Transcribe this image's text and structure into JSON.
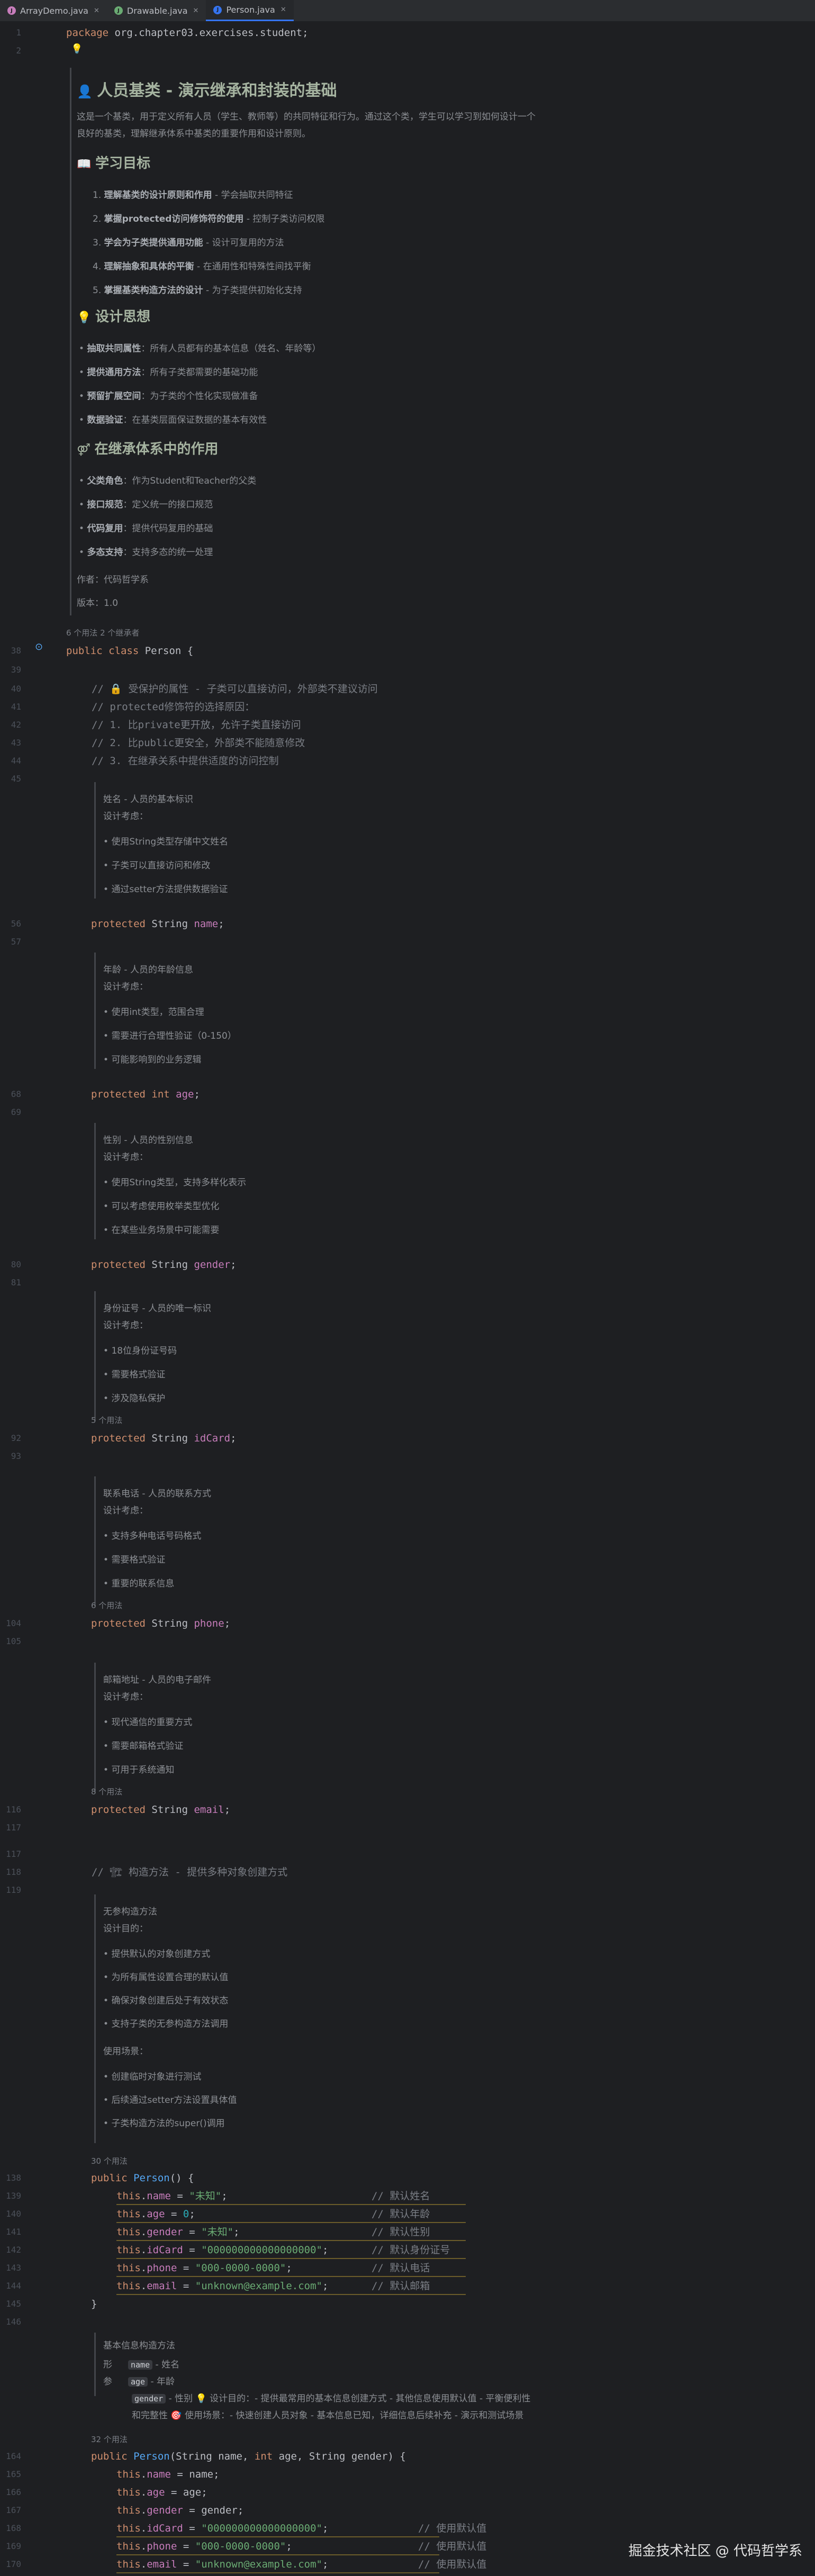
{
  "tabs": [
    {
      "label": "ArrayDemo.java",
      "icon_color": "#c77dbb"
    },
    {
      "label": "Drawable.java",
      "icon_color": "#6aab73"
    },
    {
      "label": "Person.java",
      "icon_color": "#3574f0",
      "active": true
    }
  ],
  "colors": {
    "accent": "#3574f0",
    "keyword": "#cf8e6d",
    "string": "#6aab73",
    "field": "#c77dbb",
    "comment": "#7a7e85",
    "number": "#2aacb8",
    "doc_heading": "#a5b3a0"
  },
  "code": {
    "line1": {
      "n": "1",
      "kw": "package",
      "rest": " org.chapter03.exercises.student;"
    },
    "line2": {
      "n": "2"
    },
    "doc_class": {
      "title": "人员基类 - 演示继承和封装的基础",
      "intro_1": "这是一个基类，用于定义所有人员（学生、教师等）的共同特征和行为。通过这个类，学生可以学习到如何设计一个",
      "intro_2": "良好的基类，理解继承体系中基类的重要作用和设计原则。",
      "goals_title": "学习目标",
      "goals": [
        {
          "n": "1.",
          "b": "理解基类的设计原则和作用",
          "t": " - 学会抽取共同特征"
        },
        {
          "n": "2.",
          "b": "掌握protected访问修饰符的使用",
          "t": " - 控制子类访问权限"
        },
        {
          "n": "3.",
          "b": "学会为子类提供通用功能",
          "t": " - 设计可复用的方法"
        },
        {
          "n": "4.",
          "b": "理解抽象和具体的平衡",
          "t": " - 在通用性和特殊性间找平衡"
        },
        {
          "n": "5.",
          "b": "掌握基类构造方法的设计",
          "t": " - 为子类提供初始化支持"
        }
      ],
      "thinking_title": "设计思想",
      "thinking": [
        {
          "b": "抽取共同属性",
          "t": "：所有人员都有的基本信息（姓名、年龄等）"
        },
        {
          "b": "提供通用方法",
          "t": "：所有子类都需要的基础功能"
        },
        {
          "b": "预留扩展空间",
          "t": "：为子类的个性化实现做准备"
        },
        {
          "b": "数据验证",
          "t": "：在基类层面保证数据的基本有效性"
        }
      ],
      "role_title": "在继承体系中的作用",
      "role": [
        {
          "b": "父类角色",
          "t": "：作为Student和Teacher的父类"
        },
        {
          "b": "接口规范",
          "t": "：定义统一的接口规范"
        },
        {
          "b": "代码复用",
          "t": "：提供代码复用的基础"
        },
        {
          "b": "多态支持",
          "t": "：支持多态的统一处理"
        }
      ],
      "author": "作者：代码哲学系",
      "version": "版本：1.0"
    },
    "class_hint": "6 个用法   2 个继承者",
    "class_line": {
      "n": "38",
      "kw": "public class",
      "name": " Person {"
    },
    "comments": [
      {
        "n": "40",
        "text": "// 🔒 受保护的属性 - 子类可以直接访问，外部类不建议访问"
      },
      {
        "n": "41",
        "text": "// protected修饰符的选择原因："
      },
      {
        "n": "42",
        "text": "// 1. 比private更开放，允许子类直接访问"
      },
      {
        "n": "43",
        "text": "// 2. 比public更安全，外部类不能随意修改"
      },
      {
        "n": "44",
        "text": "// 3. 在继承关系中提供适度的访问控制"
      }
    ],
    "fields": [
      {
        "doc_title": "姓名 - 人员的基本标识",
        "doc_sub": "设计考虑：",
        "items": [
          "使用String类型存储中文姓名",
          "子类可以直接访问和修改",
          "通过setter方法提供数据验证"
        ],
        "hint": "",
        "n": "56",
        "type": "String",
        "name": "name"
      },
      {
        "doc_title": "年龄 - 人员的年龄信息",
        "doc_sub": "设计考虑：",
        "items": [
          "使用int类型，范围合理",
          "需要进行合理性验证（0-150）",
          "可能影响到的业务逻辑"
        ],
        "hint": "",
        "n": "68",
        "type": "int",
        "name": "age"
      },
      {
        "doc_title": "性别 - 人员的性别信息",
        "doc_sub": "设计考虑：",
        "items": [
          "使用String类型，支持多样化表示",
          "可以考虑使用枚举类型优化",
          "在某些业务场景中可能需要"
        ],
        "hint": "",
        "n": "80",
        "type": "String",
        "name": "gender"
      },
      {
        "doc_title": "身份证号 - 人员的唯一标识",
        "doc_sub": "设计考虑：",
        "items": [
          "18位身份证号码",
          "需要格式验证",
          "涉及隐私保护"
        ],
        "hint": "5 个用法",
        "n": "92",
        "type": "String",
        "name": "idCard"
      },
      {
        "doc_title": "联系电话 - 人员的联系方式",
        "doc_sub": "设计考虑：",
        "items": [
          "支持多种电话号码格式",
          "需要格式验证",
          "重要的联系信息"
        ],
        "hint": "6 个用法",
        "n": "104",
        "type": "String",
        "name": "phone"
      },
      {
        "doc_title": "邮箱地址 - 人员的电子邮件",
        "doc_sub": "设计考虑：",
        "items": [
          "现代通信的重要方式",
          "需要邮箱格式验证",
          "可用于系统通知"
        ],
        "hint": "8 个用法",
        "n": "116",
        "type": "String",
        "name": "email"
      }
    ],
    "ctor_comment": {
      "n": "118",
      "text": "// 🏗 构造方法 - 提供多种对象创建方式"
    },
    "ctor_doc": {
      "title": "无参构造方法",
      "sub": "设计目的：",
      "items": [
        "提供默认的对象创建方式",
        "为所有属性设置合理的默认值",
        "确保对象创建后处于有效状态",
        "支持子类的无参构造方法调用"
      ],
      "sub2": "使用场景：",
      "items2": [
        "创建临时对象进行测试",
        "后续通过setter方法设置具体值",
        "子类构造方法的super()调用"
      ]
    },
    "ctor_hint": "30 个用法",
    "ctor_lines": [
      {
        "n": "138",
        "pre": "public ",
        "fn": "Person",
        "post": "() {"
      },
      {
        "n": "139",
        "fld": "name",
        "val": "\"未知\"",
        "isnum": false,
        "cm": "// 默认姓名"
      },
      {
        "n": "140",
        "fld": "age",
        "val": "0",
        "isnum": true,
        "cm": "// 默认年龄"
      },
      {
        "n": "141",
        "fld": "gender",
        "val": "\"未知\"",
        "isnum": false,
        "cm": "// 默认性别"
      },
      {
        "n": "142",
        "fld": "idCard",
        "val": "\"000000000000000000\"",
        "isnum": false,
        "cm": "// 默认身份证号"
      },
      {
        "n": "143",
        "fld": "phone",
        "val": "\"000-0000-0000\"",
        "isnum": false,
        "cm": "// 默认电话"
      },
      {
        "n": "144",
        "fld": "email",
        "val": "\"unknown@example.com\"",
        "isnum": false,
        "cm": "// 默认邮箱"
      },
      {
        "n": "145",
        "close": "}"
      },
      {
        "n": "146"
      }
    ],
    "ctor2_doc": {
      "title": "基本信息构造方法",
      "p1_label": "形",
      "p1": "name",
      "p1t": "- 姓名",
      "p2_label": "参",
      "p2": "age",
      "p2t": "- 年龄",
      "p3": "gender",
      "p3t": "- 性别 💡 设计目的：- 提供最常用的基本信息创建方式 - 其他信息使用默认值 - 平衡便利性",
      "p4": "和完整性 🎯 使用场景：- 快速创建人员对象 - 基本信息已知，详细信息后续补充 - 演示和测试场景"
    },
    "ctor2_hint": "32 个用法",
    "ctor2_lines": [
      {
        "n": "164",
        "sig": "Person(String name, int age, String gender) {"
      },
      {
        "n": "165",
        "fld": "name",
        "val": "name",
        "kind": "id",
        "cm": ""
      },
      {
        "n": "166",
        "fld": "age",
        "val": "age",
        "kind": "id",
        "cm": ""
      },
      {
        "n": "167",
        "fld": "gender",
        "val": "gender",
        "kind": "id",
        "cm": ""
      },
      {
        "n": "168",
        "fld": "idCard",
        "val": "\"000000000000000000\"",
        "kind": "str",
        "cm": "// 使用默认值"
      },
      {
        "n": "169",
        "fld": "phone",
        "val": "\"000-0000-0000\"",
        "kind": "str",
        "cm": "// 使用默认值"
      },
      {
        "n": "170",
        "fld": "email",
        "val": "\"unknown@example.com\"",
        "kind": "str",
        "cm": "// 使用默认值"
      }
    ]
  },
  "watermark": "掘金技术社区 @ 代码哲学系"
}
